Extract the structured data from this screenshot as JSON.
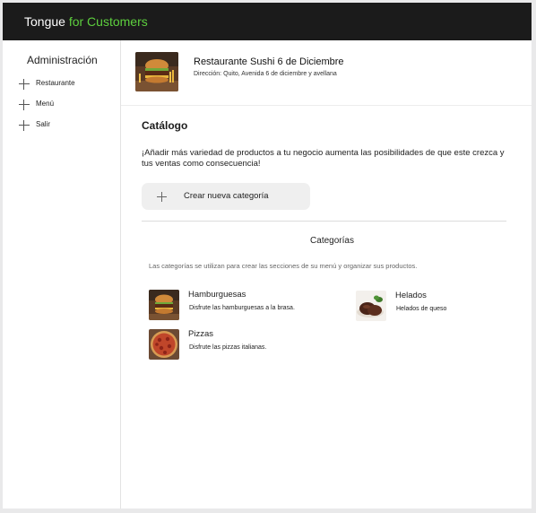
{
  "app": {
    "brand_main": "Tongue",
    "brand_accent": " for Customers",
    "accent_color": "#5dcf3e",
    "topbar_color": "#1b1b1b"
  },
  "sidebar": {
    "title": "Administración",
    "items": [
      {
        "label": "Restaurante",
        "icon": "plus-icon"
      },
      {
        "label": "Menú",
        "icon": "plus-icon"
      },
      {
        "label": "Salir",
        "icon": "plus-icon"
      }
    ]
  },
  "restaurant": {
    "name": "Restaurante Sushi 6 de Diciembre",
    "address": "Dirección: Quito, Avenida 6 de diciembre y avellana",
    "image": "burger-photo"
  },
  "catalog": {
    "title": "Catálogo",
    "intro": "¡Añadir más variedad de productos a tu negocio aumenta las posibilidades de que este crezca y tus ventas como consecuencia!",
    "new_category_label": "Crear nueva categoría"
  },
  "categories": {
    "title": "Categorías",
    "description": "Las categorías se utilizan para crear las secciones de su menú y organizar sus productos.",
    "items": [
      {
        "name": "Hamburguesas",
        "desc": "Disfrute las hamburguesas a la brasa.",
        "image": "burger-photo"
      },
      {
        "name": "Helados",
        "desc": "Helados de queso",
        "image": "chocolate-ice-cream-photo"
      },
      {
        "name": "Pizzas",
        "desc": "Disfrute las pizzas italianas.",
        "image": "pizza-photo"
      }
    ]
  }
}
